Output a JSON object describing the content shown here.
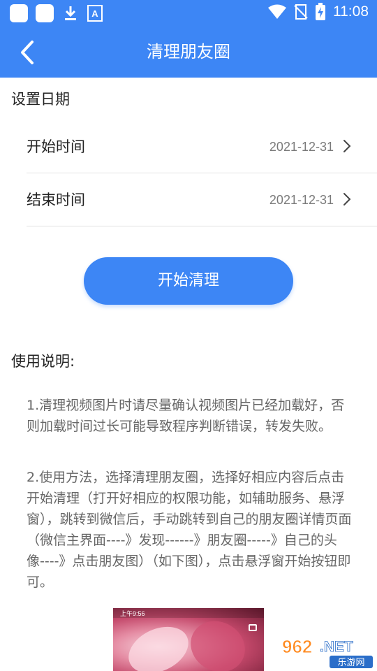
{
  "status_bar": {
    "time": "11:08",
    "left_icons": [
      "app-icon",
      "app-icon",
      "download-icon",
      "a-icon"
    ],
    "right_icons": [
      "wifi-icon",
      "no-sim-icon",
      "battery-charging-icon"
    ]
  },
  "header": {
    "title": "清理朋友圈",
    "back_icon": "chevron-left-icon"
  },
  "date_section": {
    "heading": "设置日期",
    "rows": [
      {
        "label": "开始时间",
        "value": "2021-12-31"
      },
      {
        "label": "结束时间",
        "value": "2021-12-31"
      }
    ]
  },
  "start_button": {
    "label": "开始清理"
  },
  "instructions": {
    "heading": "使用说明:",
    "paragraphs": [
      "1.清理视频图片时请尽量确认视频图片已经加载好，否则加载时间过长可能导致程序判断错误，转发失败。",
      "2.使用方法，选择清理朋友圈，选择好相应内容后点击开始清理（打开好相应的权限功能，如辅助服务、悬浮窗），跳转到微信后，手动跳转到自己的朋友圈详情页面（微信主界面----》发现------》朋友圈-----》自己的头像----》点击朋友图）（如下图），点击悬浮窗开始按钮即可。"
    ]
  },
  "preview_image": {
    "status_time": "上午9:56"
  },
  "watermark": {
    "text": "962.NET 乐游网"
  },
  "colors": {
    "primary": "#3d86f5",
    "divider": "#e3e3e3",
    "muted_text": "#7a7a7a",
    "body_text": "#666666"
  }
}
